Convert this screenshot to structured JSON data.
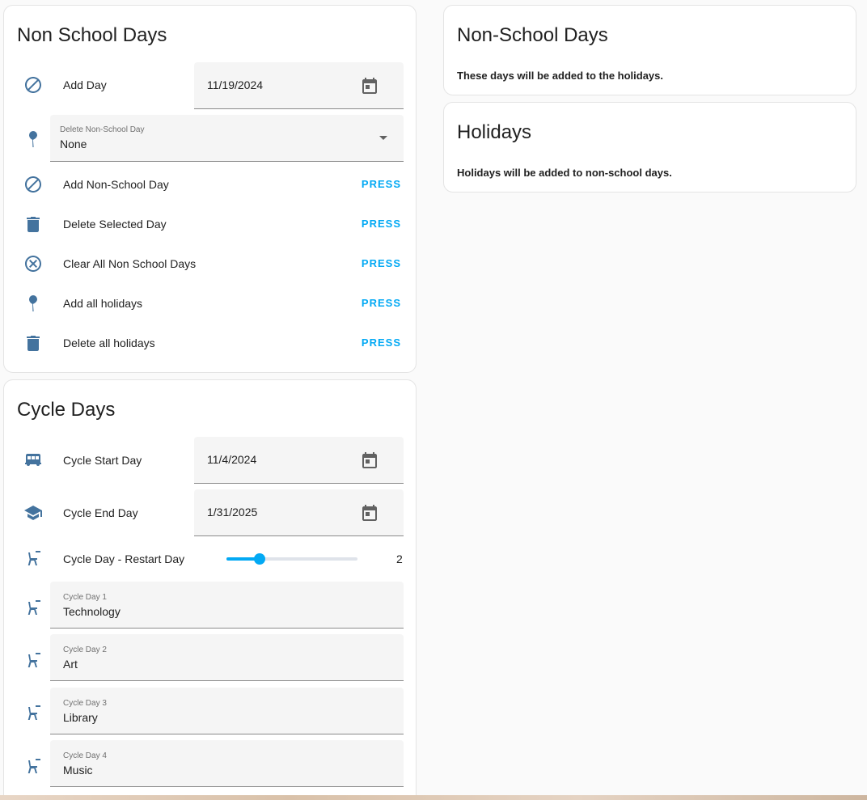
{
  "non_school_card": {
    "title": "Non School Days",
    "add_day": {
      "label": "Add Day",
      "value": "11/19/2024",
      "icon": "cancel-icon"
    },
    "delete_select": {
      "caption": "Delete Non-School Day",
      "value": "None",
      "icon": "pin-icon"
    },
    "buttons": [
      {
        "label": "Add Non-School Day",
        "action": "PRESS",
        "icon": "cancel-icon"
      },
      {
        "label": "Delete Selected Day",
        "action": "PRESS",
        "icon": "trash-icon"
      },
      {
        "label": "Clear All Non School Days",
        "action": "PRESS",
        "icon": "close-circle-icon"
      },
      {
        "label": "Add all holidays",
        "action": "PRESS",
        "icon": "pin-icon"
      },
      {
        "label": "Delete all holidays",
        "action": "PRESS",
        "icon": "trash-icon"
      }
    ]
  },
  "cycle_card": {
    "title": "Cycle Days",
    "start_day": {
      "label": "Cycle Start Day",
      "value": "11/4/2024",
      "icon": "bus-icon"
    },
    "end_day": {
      "label": "Cycle End Day",
      "value": "1/31/2025",
      "icon": "graduation-cap-icon"
    },
    "restart": {
      "label": "Cycle Day - Restart Day",
      "value": "2",
      "fraction": 0.25,
      "icon": "desk-icon"
    },
    "days": [
      {
        "caption": "Cycle Day 1",
        "value": "Technology"
      },
      {
        "caption": "Cycle Day 2",
        "value": "Art"
      },
      {
        "caption": "Cycle Day 3",
        "value": "Library"
      },
      {
        "caption": "Cycle Day 4",
        "value": "Music"
      }
    ]
  },
  "non_school_info": {
    "title": "Non-School Days",
    "text": "These days will be added to the holidays."
  },
  "holidays_info": {
    "title": "Holidays",
    "text": "Holidays will be added to non-school days."
  },
  "colors": {
    "icon": "#44739e",
    "accent": "#03a9f4",
    "background": "#fafafa",
    "field": "#f5f5f5"
  }
}
